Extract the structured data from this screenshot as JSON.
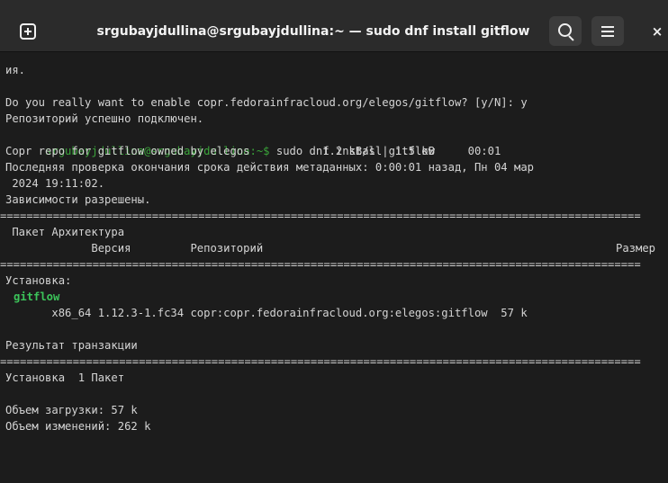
{
  "window": {
    "title": "srgubayjdullina@srgubayjdullina:~ — sudo dnf install gitflow",
    "icons": [
      "new-tab-icon",
      "search-icon",
      "hamburger-menu-icon",
      "close-icon"
    ],
    "close_glyph": "×"
  },
  "colors": {
    "background": "#1c1c1c",
    "titlebar": "#2b2b2b",
    "text": "#d4d4d4",
    "prompt": "#3aa53a",
    "package": "#3cc45a"
  },
  "terminal": {
    "lines": [
      "ия.",
      "",
      "Do you really want to enable copr.fedorainfracloud.org/elegos/gitflow? [y/N]: y",
      "Репозиторий успешно подключен.",
      "",
      "Copr repo for gitflow owned by elegos           1.2 kB/s | 1.5 kB     00:01",
      "Последняя проверка окончания срока действия метаданных: 0:00:01 назад, Пн 04 мар",
      " 2024 19:11:02.",
      "Зависимости разрешены.",
      "=================================================================================================",
      " Пакет Архитектура",
      "             Версия         Репозиторий",
      "=================================================================================================",
      "Установка:",
      "",
      "       x86_64 1.12.3-1.fc34 copr:copr.fedorainfracloud.org:elegos:gitflow  57 k",
      "",
      "Результат транзакции",
      "=================================================================================================",
      "Установка  1 Пакет",
      "",
      "Объем загрузки: 57 k",
      "Объем изменений: 262 k"
    ],
    "prompt_text": "srgubayjdullina@srgubayjdullina:~$",
    "command": " sudo dnf install gitflow",
    "package_name": "gitflow",
    "size_header": "Размер"
  }
}
